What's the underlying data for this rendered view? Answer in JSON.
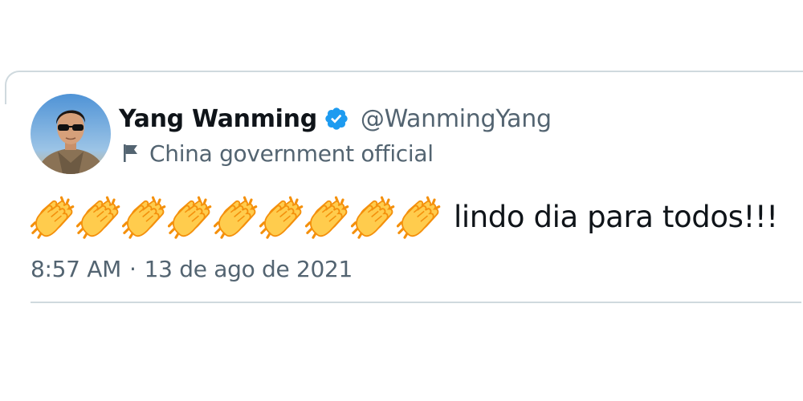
{
  "tweet": {
    "author": {
      "display_name": "Yang Wanming",
      "handle": "@WanmingYang",
      "verified": true,
      "label": "China government official",
      "avatar_icon": "profile-photo"
    },
    "text": "lindo dia para todos!!!",
    "emoji": {
      "icon": "clapping-hands-icon",
      "count": 9
    },
    "time": "8:57 AM",
    "separator": "·",
    "date": "13 de ago de 2021"
  },
  "colors": {
    "text_primary": "#0f1419",
    "text_secondary": "#536471",
    "verified_blue": "#1d9bf0",
    "border": "#cfd9de",
    "clap_yellow": "#ffcc4d",
    "clap_orange": "#f4900c"
  }
}
